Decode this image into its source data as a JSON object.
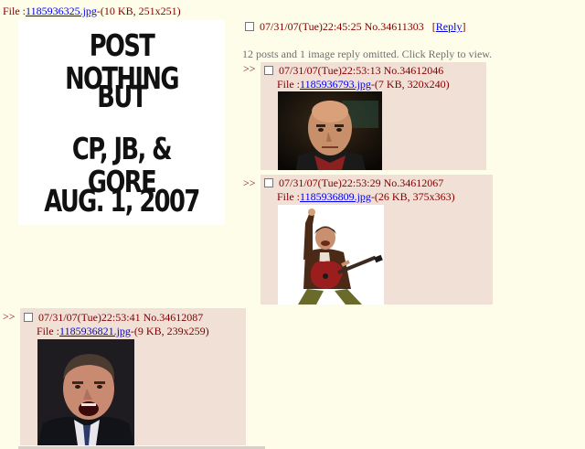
{
  "op": {
    "file_prefix": "File :",
    "file_link": "1185936325.jpg",
    "file_meta": "-(10 KB, 251x251)",
    "image_alt": "POST NOTHING BUT CP, JB, & GORE AUG. 1, 2007",
    "poster_lines": [
      "POST NOTHING",
      "BUT",
      "CP, JB, & GORE",
      "AUG. 1, 2007"
    ],
    "datetime": "07/31/07(Tue)22:45:25",
    "post_no": "No.34611303",
    "reply_label": "Reply",
    "reply_open": "[",
    "reply_close": "]",
    "omitted": "12 posts and 1 image reply omitted. Click Reply to view."
  },
  "replies": [
    {
      "arrows": ">>",
      "datetime": "07/31/07(Tue)22:53:13",
      "post_no": "No.34612046",
      "file_prefix": "File :",
      "file_link": "1185936793.jpg",
      "file_meta": "-(7 KB, 320x240)"
    },
    {
      "arrows": ">>",
      "datetime": "07/31/07(Tue)22:53:29",
      "post_no": "No.34612067",
      "file_prefix": "File :",
      "file_link": "1185936809.jpg",
      "file_meta": "-(26 KB, 375x363)"
    },
    {
      "arrows": ">>",
      "datetime": "07/31/07(Tue)22:53:41",
      "post_no": "No.34612087",
      "file_prefix": "File :",
      "file_link": "1185936821.jpg",
      "file_meta": "-(9 KB, 239x259)"
    }
  ],
  "colors": {
    "page_bg": "#fefde9",
    "reply_bg": "#f0e0d6",
    "text": "#800000",
    "link": "#0000ee"
  }
}
